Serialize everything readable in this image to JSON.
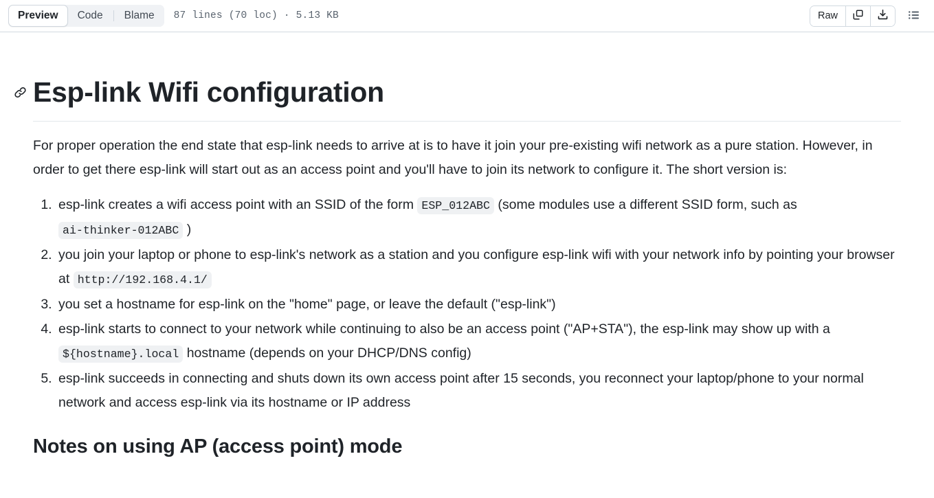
{
  "header": {
    "tabs": [
      {
        "label": "Preview",
        "active": true
      },
      {
        "label": "Code",
        "active": false
      },
      {
        "label": "Blame",
        "active": false
      }
    ],
    "file_meta": "87 lines (70 loc) · 5.13 KB",
    "raw_label": "Raw",
    "copy_icon": "copy-icon",
    "download_icon": "download-icon",
    "toc_icon": "list-unordered-icon"
  },
  "article": {
    "anchor_icon": "link-icon",
    "title": "Esp-link Wifi configuration",
    "intro": "For proper operation the end state that esp-link needs to arrive at is to have it join your pre-existing wifi network as a pure station. However, in order to get there esp-link will start out as an access point and you'll have to join its network to configure it. The short version is:",
    "steps": [
      {
        "parts": [
          {
            "type": "text",
            "value": "esp-link creates a wifi access point with an SSID of the form "
          },
          {
            "type": "code",
            "value": "ESP_012ABC"
          },
          {
            "type": "text",
            "value": " (some modules use a different SSID form, such as "
          },
          {
            "type": "code",
            "value": "ai-thinker-012ABC"
          },
          {
            "type": "text",
            "value": " )"
          }
        ]
      },
      {
        "parts": [
          {
            "type": "text",
            "value": "you join your laptop or phone to esp-link's network as a station and you configure esp-link wifi with your network info by pointing your browser at "
          },
          {
            "type": "code",
            "value": "http://192.168.4.1/"
          }
        ]
      },
      {
        "parts": [
          {
            "type": "text",
            "value": "you set a hostname for esp-link on the \"home\" page, or leave the default (\"esp-link\")"
          }
        ]
      },
      {
        "parts": [
          {
            "type": "text",
            "value": "esp-link starts to connect to your network while continuing to also be an access point (\"AP+STA\"), the esp-link may show up with a "
          },
          {
            "type": "code",
            "value": "${hostname}.local"
          },
          {
            "type": "text",
            "value": " hostname (depends on your DHCP/DNS config)"
          }
        ]
      },
      {
        "parts": [
          {
            "type": "text",
            "value": "esp-link succeeds in connecting and shuts down its own access point after 15 seconds, you reconnect your laptop/phone to your normal network and access esp-link via its hostname or IP address"
          }
        ]
      }
    ],
    "section_heading": "Notes on using AP (access point) mode"
  },
  "colors": {
    "text": "#1f2328",
    "muted": "#59636e",
    "border": "#d1d9e0",
    "code_bg": "#eff1f3",
    "seg_bg": "#f0f2f5"
  }
}
